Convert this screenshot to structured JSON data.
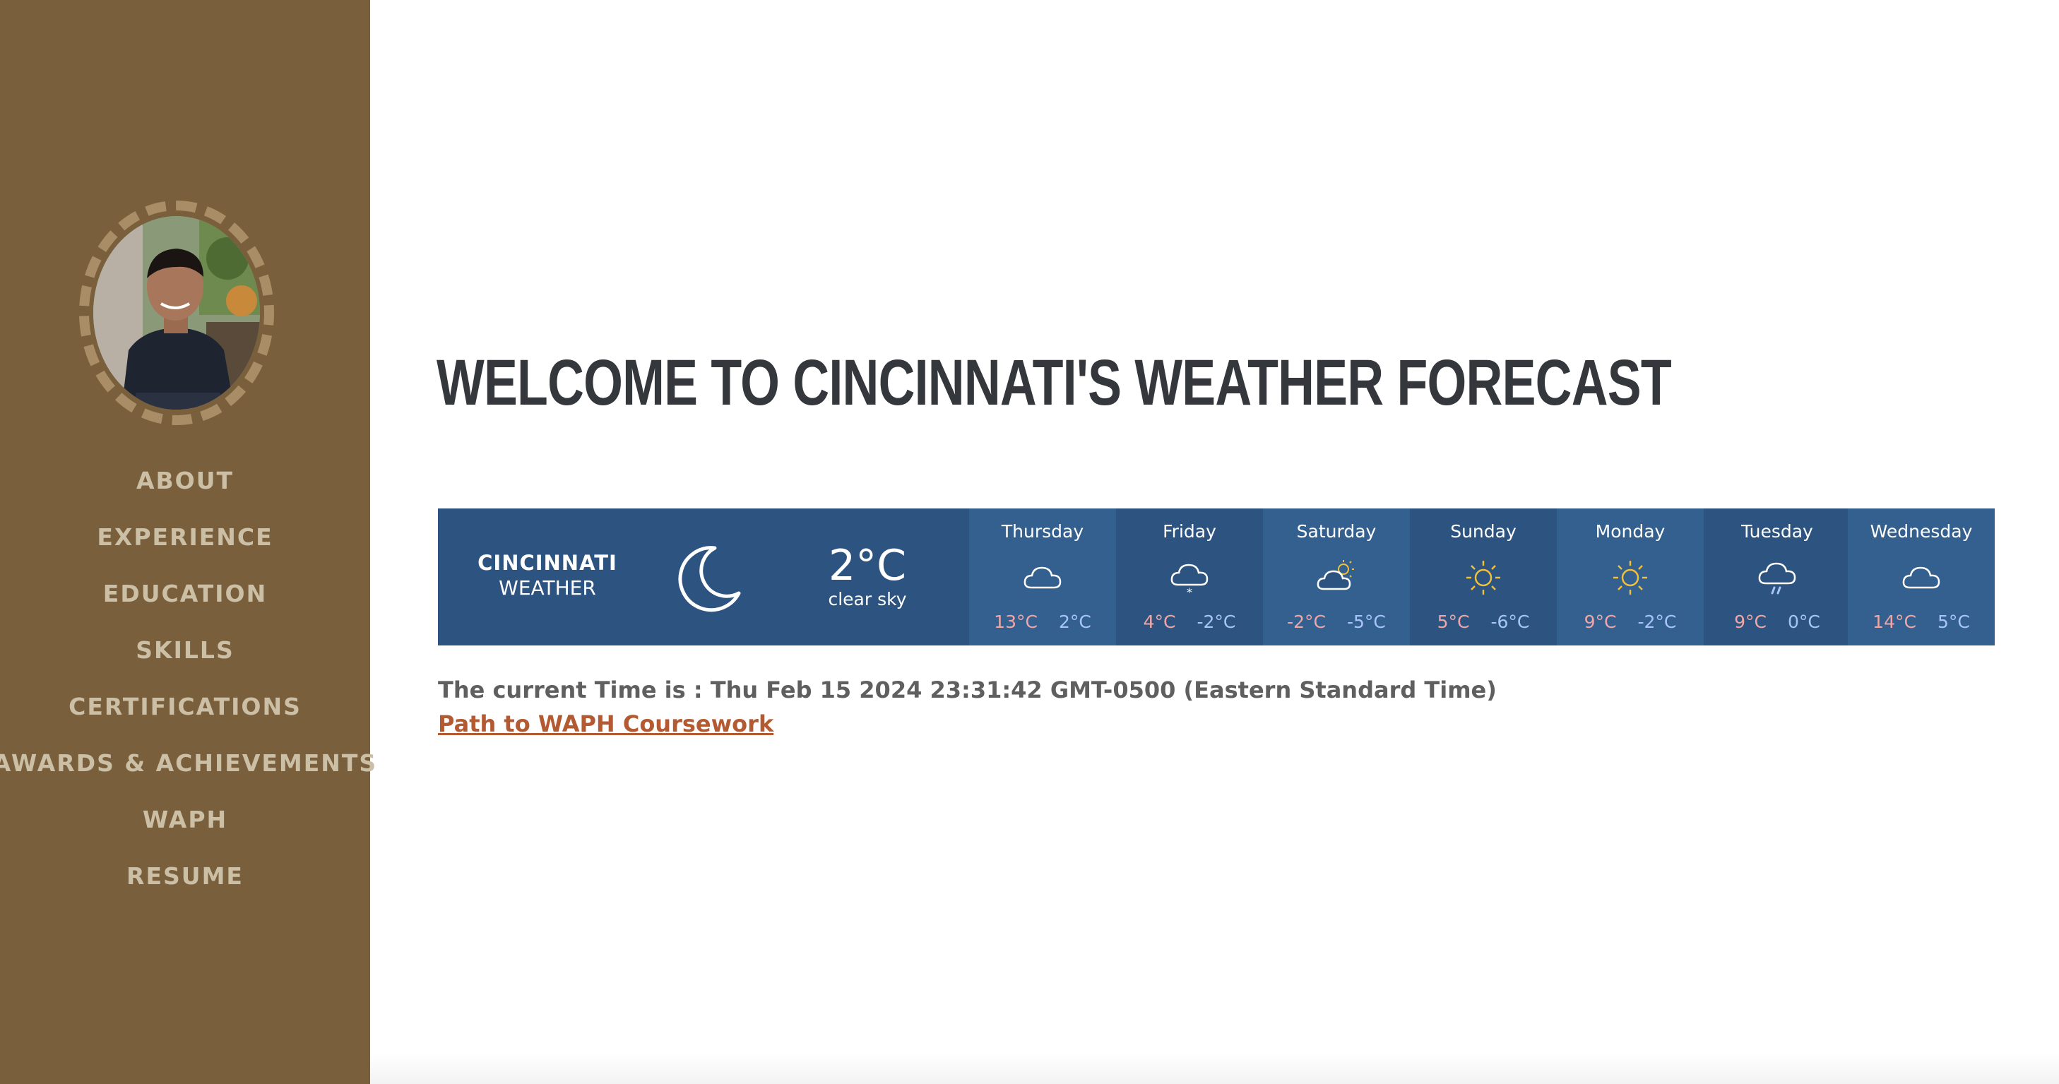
{
  "sidebar": {
    "nav_items": [
      {
        "label": "ABOUT"
      },
      {
        "label": "EXPERIENCE"
      },
      {
        "label": "EDUCATION"
      },
      {
        "label": "SKILLS"
      },
      {
        "label": "CERTIFICATIONS"
      },
      {
        "label": "AWARDS & ACHIEVEMENTS"
      },
      {
        "label": "WAPH"
      },
      {
        "label": "RESUME"
      }
    ]
  },
  "main": {
    "title": "WELCOME TO CINCINNATI'S WEATHER FORECAST",
    "time_text": "The current Time is : Thu Feb 15 2024 23:31:42 GMT-0500 (Eastern Standard Time)",
    "link_text": "Path to WAPH Coursework"
  },
  "weather": {
    "city": "CINCINNATI",
    "city_sub": "WEATHER",
    "current_icon": "moon-icon",
    "current_temp": "2°C",
    "current_desc": "clear sky",
    "days": [
      {
        "name": "Thursday",
        "icon": "cloud-icon",
        "hi": "13°C",
        "lo": "2°C"
      },
      {
        "name": "Friday",
        "icon": "snow-cloud-icon",
        "hi": "4°C",
        "lo": "-2°C"
      },
      {
        "name": "Saturday",
        "icon": "partly-cloudy-icon",
        "hi": "-2°C",
        "lo": "-5°C"
      },
      {
        "name": "Sunday",
        "icon": "sun-icon",
        "hi": "5°C",
        "lo": "-6°C"
      },
      {
        "name": "Monday",
        "icon": "sun-icon",
        "hi": "9°C",
        "lo": "-2°C"
      },
      {
        "name": "Tuesday",
        "icon": "rain-cloud-icon",
        "hi": "9°C",
        "lo": "0°C"
      },
      {
        "name": "Wednesday",
        "icon": "cloud-icon",
        "hi": "14°C",
        "lo": "5°C"
      }
    ]
  },
  "colors": {
    "sidebar_bg": "#7a5f3c",
    "nav_text": "#cbbfa6",
    "widget_bg": "#2d5480",
    "link": "#b45a32",
    "high_temp": "#f0a6a6",
    "low_temp": "#a7c6f5",
    "sun": "#f2c037"
  }
}
